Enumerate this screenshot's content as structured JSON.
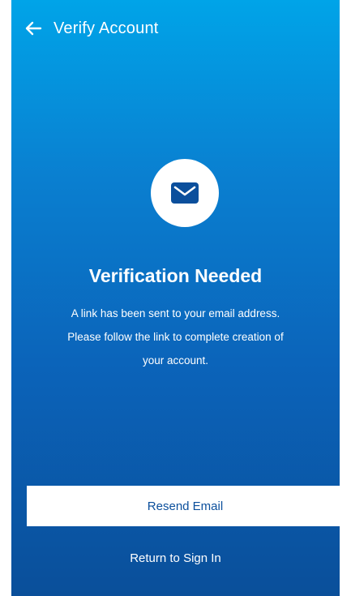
{
  "header": {
    "back_icon": "arrow-left-icon",
    "title": "Verify Account"
  },
  "main": {
    "icon": "envelope-icon",
    "heading": "Verification Needed",
    "message_lines": [
      "A link has been sent to your email address.",
      "Please follow the link to complete creation of",
      "your account."
    ]
  },
  "actions": {
    "resend_label": "Resend Email",
    "return_label": "Return to Sign In"
  },
  "colors": {
    "gradient_top": "#00a4e8",
    "gradient_bottom": "#0a4f9a",
    "button_text": "#0b4f9c",
    "icon_fill": "#0b4f9c",
    "surface": "#ffffff"
  }
}
